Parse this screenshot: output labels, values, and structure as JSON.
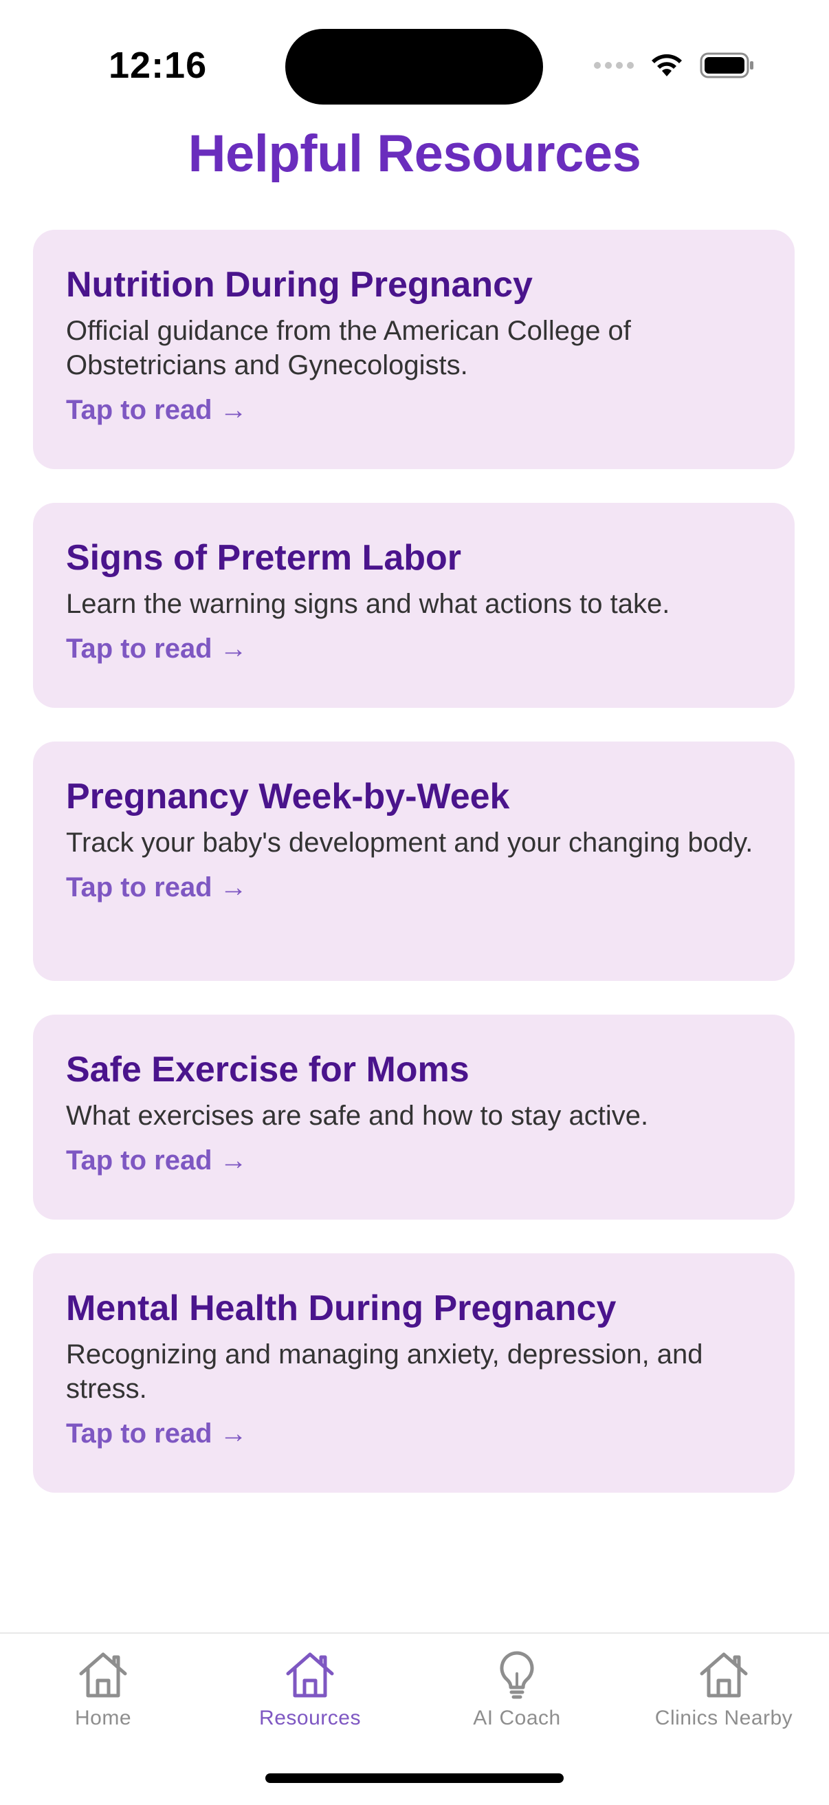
{
  "status_bar": {
    "time": "12:16",
    "icons": [
      "signal-dots-icon",
      "wifi-icon",
      "battery-icon"
    ]
  },
  "page": {
    "title": "Helpful Resources"
  },
  "resources": [
    {
      "title": "Nutrition During Pregnancy",
      "description": "Official guidance from the American College of Obstetricians and Gynecologists.",
      "link_label": "Tap to read →"
    },
    {
      "title": "Signs of Preterm Labor",
      "description": "Learn the warning signs and what actions to take.",
      "link_label": "Tap to read →"
    },
    {
      "title": "Pregnancy Week-by-Week",
      "description": "Track your baby's development and your changing body.",
      "link_label": "Tap to read →"
    },
    {
      "title": "Safe Exercise for Moms",
      "description": "What exercises are safe and how to stay active.",
      "link_label": "Tap to read →"
    },
    {
      "title": "Mental Health During Pregnancy",
      "description": "Recognizing and managing anxiety, depression, and stress.",
      "link_label": "Tap to read →"
    }
  ],
  "tab_bar": {
    "tabs": [
      {
        "label": "Home",
        "icon": "house-icon",
        "active": false
      },
      {
        "label": "Resources",
        "icon": "house-icon",
        "active": true
      },
      {
        "label": "AI Coach",
        "icon": "lightbulb-icon",
        "active": false
      },
      {
        "label": "Clinics Nearby",
        "icon": "house-icon",
        "active": false
      }
    ]
  },
  "colors": {
    "accent": "#6a2dbd",
    "card_background": "#f3e5f5",
    "card_title": "#4a148c",
    "link": "#7e57c2",
    "tab_inactive": "#8e8e8e"
  }
}
